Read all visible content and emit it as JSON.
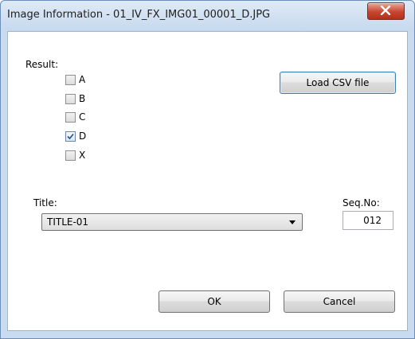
{
  "window": {
    "title": "Image Information - 01_IV_FX_IMG01_00001_D.JPG"
  },
  "result": {
    "label": "Result:",
    "options": [
      {
        "label": "A",
        "checked": false
      },
      {
        "label": "B",
        "checked": false
      },
      {
        "label": "C",
        "checked": false
      },
      {
        "label": "D",
        "checked": true
      },
      {
        "label": "X",
        "checked": false
      }
    ]
  },
  "load_csv_label": "Load CSV file",
  "title_field": {
    "label": "Title:",
    "value": "TITLE-01"
  },
  "seq_field": {
    "label": "Seq.No:",
    "value": "012"
  },
  "ok_label": "OK",
  "cancel_label": "Cancel",
  "colors": {
    "window_frame": "#c9dcef",
    "close_button": "#c7452f",
    "default_button_border": "#3c7fb1"
  }
}
